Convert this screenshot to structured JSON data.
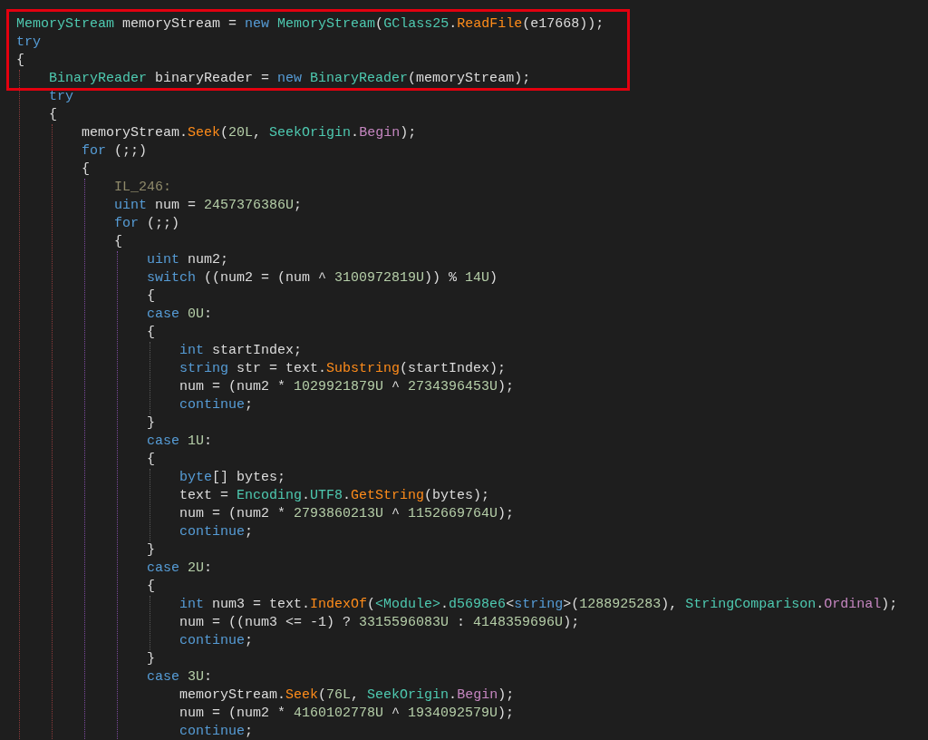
{
  "editor": {
    "lines": [
      {
        "highlighted": true,
        "tokens": [
          {
            "kind": "type",
            "text": "MemoryStream"
          },
          {
            "kind": "plain",
            "text": " memoryStream = "
          },
          {
            "kind": "keyword",
            "text": "new"
          },
          {
            "kind": "type",
            "text": " MemoryStream"
          },
          {
            "kind": "plain",
            "text": "("
          },
          {
            "kind": "type",
            "text": "GClass25"
          },
          {
            "kind": "plain",
            "text": "."
          },
          {
            "kind": "method",
            "text": "ReadFile"
          },
          {
            "kind": "plain",
            "text": "(e17668));"
          }
        ]
      },
      {
        "highlighted": true,
        "tokens": [
          {
            "kind": "keyword",
            "text": "try"
          }
        ]
      },
      {
        "highlighted": true,
        "tokens": [
          {
            "kind": "plain",
            "text": "{"
          }
        ],
        "guide": true,
        "children": [
          {
            "highlighted": true,
            "tokens": [
              {
                "kind": "type",
                "text": "BinaryReader"
              },
              {
                "kind": "plain",
                "text": " binaryReader = "
              },
              {
                "kind": "keyword",
                "text": "new"
              },
              {
                "kind": "type",
                "text": " BinaryReader"
              },
              {
                "kind": "plain",
                "text": "(memoryStream);"
              }
            ]
          },
          {
            "highlighted": false,
            "tokens": [
              {
                "kind": "keyword",
                "text": "try"
              }
            ]
          },
          {
            "highlighted": false,
            "tokens": [
              {
                "kind": "plain",
                "text": "{"
              }
            ],
            "guide": true,
            "children": [
              {
                "highlighted": false,
                "tokens": [
                  {
                    "kind": "plain",
                    "text": "memoryStream."
                  },
                  {
                    "kind": "method",
                    "text": "Seek"
                  },
                  {
                    "kind": "plain",
                    "text": "("
                  },
                  {
                    "kind": "number",
                    "text": "20L"
                  },
                  {
                    "kind": "plain",
                    "text": ", "
                  },
                  {
                    "kind": "type",
                    "text": "SeekOrigin"
                  },
                  {
                    "kind": "plain",
                    "text": "."
                  },
                  {
                    "kind": "member",
                    "text": "Begin"
                  },
                  {
                    "kind": "plain",
                    "text": ");"
                  }
                ]
              },
              {
                "highlighted": false,
                "tokens": [
                  {
                    "kind": "keyword",
                    "text": "for"
                  },
                  {
                    "kind": "plain",
                    "text": " (;;)"
                  }
                ]
              },
              {
                "highlighted": false,
                "tokens": [
                  {
                    "kind": "plain",
                    "text": "{"
                  }
                ],
                "guide": true,
                "children": [
                  {
                    "highlighted": false,
                    "tokens": [
                      {
                        "kind": "label",
                        "text": "IL_246:"
                      }
                    ]
                  },
                  {
                    "highlighted": false,
                    "tokens": [
                      {
                        "kind": "keyword",
                        "text": "uint"
                      },
                      {
                        "kind": "plain",
                        "text": " num = "
                      },
                      {
                        "kind": "number",
                        "text": "2457376386U"
                      },
                      {
                        "kind": "plain",
                        "text": ";"
                      }
                    ]
                  },
                  {
                    "highlighted": false,
                    "tokens": [
                      {
                        "kind": "keyword",
                        "text": "for"
                      },
                      {
                        "kind": "plain",
                        "text": " (;;)"
                      }
                    ]
                  },
                  {
                    "highlighted": false,
                    "tokens": [
                      {
                        "kind": "plain",
                        "text": "{"
                      }
                    ],
                    "guide": true,
                    "children": [
                      {
                        "highlighted": false,
                        "tokens": [
                          {
                            "kind": "keyword",
                            "text": "uint"
                          },
                          {
                            "kind": "plain",
                            "text": " num2;"
                          }
                        ]
                      },
                      {
                        "highlighted": false,
                        "tokens": [
                          {
                            "kind": "keyword",
                            "text": "switch"
                          },
                          {
                            "kind": "plain",
                            "text": " ((num2 = (num ^ "
                          },
                          {
                            "kind": "number",
                            "text": "3100972819U"
                          },
                          {
                            "kind": "plain",
                            "text": ")) % "
                          },
                          {
                            "kind": "number",
                            "text": "14U"
                          },
                          {
                            "kind": "plain",
                            "text": ")"
                          }
                        ]
                      },
                      {
                        "highlighted": false,
                        "tokens": [
                          {
                            "kind": "plain",
                            "text": "{"
                          }
                        ]
                      },
                      {
                        "highlighted": false,
                        "tokens": [
                          {
                            "kind": "keyword",
                            "text": "case"
                          },
                          {
                            "kind": "number",
                            "text": " 0U"
                          },
                          {
                            "kind": "plain",
                            "text": ":"
                          }
                        ]
                      },
                      {
                        "highlighted": false,
                        "tokens": [
                          {
                            "kind": "plain",
                            "text": "{"
                          }
                        ],
                        "guide": true,
                        "children": [
                          {
                            "highlighted": false,
                            "tokens": [
                              {
                                "kind": "keyword",
                                "text": "int"
                              },
                              {
                                "kind": "plain",
                                "text": " startIndex;"
                              }
                            ]
                          },
                          {
                            "highlighted": false,
                            "tokens": [
                              {
                                "kind": "keyword",
                                "text": "string"
                              },
                              {
                                "kind": "plain",
                                "text": " str = text."
                              },
                              {
                                "kind": "method",
                                "text": "Substring"
                              },
                              {
                                "kind": "plain",
                                "text": "(startIndex);"
                              }
                            ]
                          },
                          {
                            "highlighted": false,
                            "tokens": [
                              {
                                "kind": "plain",
                                "text": "num = (num2 * "
                              },
                              {
                                "kind": "number",
                                "text": "1029921879U"
                              },
                              {
                                "kind": "plain",
                                "text": " ^ "
                              },
                              {
                                "kind": "number",
                                "text": "2734396453U"
                              },
                              {
                                "kind": "plain",
                                "text": ");"
                              }
                            ]
                          },
                          {
                            "highlighted": false,
                            "tokens": [
                              {
                                "kind": "keyword",
                                "text": "continue"
                              },
                              {
                                "kind": "plain",
                                "text": ";"
                              }
                            ]
                          }
                        ]
                      },
                      {
                        "highlighted": false,
                        "tokens": [
                          {
                            "kind": "plain",
                            "text": "}"
                          }
                        ]
                      },
                      {
                        "highlighted": false,
                        "tokens": [
                          {
                            "kind": "keyword",
                            "text": "case"
                          },
                          {
                            "kind": "number",
                            "text": " 1U"
                          },
                          {
                            "kind": "plain",
                            "text": ":"
                          }
                        ]
                      },
                      {
                        "highlighted": false,
                        "tokens": [
                          {
                            "kind": "plain",
                            "text": "{"
                          }
                        ],
                        "guide": true,
                        "children": [
                          {
                            "highlighted": false,
                            "tokens": [
                              {
                                "kind": "keyword",
                                "text": "byte"
                              },
                              {
                                "kind": "plain",
                                "text": "[] bytes;"
                              }
                            ]
                          },
                          {
                            "highlighted": false,
                            "tokens": [
                              {
                                "kind": "plain",
                                "text": "text = "
                              },
                              {
                                "kind": "type",
                                "text": "Encoding"
                              },
                              {
                                "kind": "plain",
                                "text": "."
                              },
                              {
                                "kind": "type",
                                "text": "UTF8"
                              },
                              {
                                "kind": "plain",
                                "text": "."
                              },
                              {
                                "kind": "method",
                                "text": "GetString"
                              },
                              {
                                "kind": "plain",
                                "text": "(bytes);"
                              }
                            ]
                          },
                          {
                            "highlighted": false,
                            "tokens": [
                              {
                                "kind": "plain",
                                "text": "num = (num2 * "
                              },
                              {
                                "kind": "number",
                                "text": "2793860213U"
                              },
                              {
                                "kind": "plain",
                                "text": " ^ "
                              },
                              {
                                "kind": "number",
                                "text": "1152669764U"
                              },
                              {
                                "kind": "plain",
                                "text": ");"
                              }
                            ]
                          },
                          {
                            "highlighted": false,
                            "tokens": [
                              {
                                "kind": "keyword",
                                "text": "continue"
                              },
                              {
                                "kind": "plain",
                                "text": ";"
                              }
                            ]
                          }
                        ]
                      },
                      {
                        "highlighted": false,
                        "tokens": [
                          {
                            "kind": "plain",
                            "text": "}"
                          }
                        ]
                      },
                      {
                        "highlighted": false,
                        "tokens": [
                          {
                            "kind": "keyword",
                            "text": "case"
                          },
                          {
                            "kind": "number",
                            "text": " 2U"
                          },
                          {
                            "kind": "plain",
                            "text": ":"
                          }
                        ]
                      },
                      {
                        "highlighted": false,
                        "tokens": [
                          {
                            "kind": "plain",
                            "text": "{"
                          }
                        ],
                        "guide": true,
                        "children": [
                          {
                            "highlighted": false,
                            "tokens": [
                              {
                                "kind": "keyword",
                                "text": "int"
                              },
                              {
                                "kind": "plain",
                                "text": " num3 = text."
                              },
                              {
                                "kind": "method",
                                "text": "IndexOf"
                              },
                              {
                                "kind": "plain",
                                "text": "("
                              },
                              {
                                "kind": "type",
                                "text": "<Module>"
                              },
                              {
                                "kind": "plain",
                                "text": "."
                              },
                              {
                                "kind": "type",
                                "text": "d5698e6"
                              },
                              {
                                "kind": "plain",
                                "text": "<"
                              },
                              {
                                "kind": "keyword",
                                "text": "string"
                              },
                              {
                                "kind": "plain",
                                "text": ">("
                              },
                              {
                                "kind": "number",
                                "text": "1288925283"
                              },
                              {
                                "kind": "plain",
                                "text": "), "
                              },
                              {
                                "kind": "type",
                                "text": "StringComparison"
                              },
                              {
                                "kind": "plain",
                                "text": "."
                              },
                              {
                                "kind": "member",
                                "text": "Ordinal"
                              },
                              {
                                "kind": "plain",
                                "text": ");"
                              }
                            ]
                          },
                          {
                            "highlighted": false,
                            "tokens": [
                              {
                                "kind": "plain",
                                "text": "num = ((num3 <= -1) ? "
                              },
                              {
                                "kind": "number",
                                "text": "3315596083U"
                              },
                              {
                                "kind": "plain",
                                "text": " : "
                              },
                              {
                                "kind": "number",
                                "text": "4148359696U"
                              },
                              {
                                "kind": "plain",
                                "text": ");"
                              }
                            ]
                          },
                          {
                            "highlighted": false,
                            "tokens": [
                              {
                                "kind": "keyword",
                                "text": "continue"
                              },
                              {
                                "kind": "plain",
                                "text": ";"
                              }
                            ]
                          }
                        ]
                      },
                      {
                        "highlighted": false,
                        "tokens": [
                          {
                            "kind": "plain",
                            "text": "}"
                          }
                        ]
                      },
                      {
                        "highlighted": false,
                        "tokens": [
                          {
                            "kind": "keyword",
                            "text": "case"
                          },
                          {
                            "kind": "number",
                            "text": " 3U"
                          },
                          {
                            "kind": "plain",
                            "text": ":"
                          }
                        ],
                        "guide": false,
                        "children": [
                          {
                            "highlighted": false,
                            "tokens": [
                              {
                                "kind": "plain",
                                "text": "memoryStream."
                              },
                              {
                                "kind": "method",
                                "text": "Seek"
                              },
                              {
                                "kind": "plain",
                                "text": "("
                              },
                              {
                                "kind": "number",
                                "text": "76L"
                              },
                              {
                                "kind": "plain",
                                "text": ", "
                              },
                              {
                                "kind": "type",
                                "text": "SeekOrigin"
                              },
                              {
                                "kind": "plain",
                                "text": "."
                              },
                              {
                                "kind": "member",
                                "text": "Begin"
                              },
                              {
                                "kind": "plain",
                                "text": ");"
                              }
                            ]
                          },
                          {
                            "highlighted": false,
                            "tokens": [
                              {
                                "kind": "plain",
                                "text": "num = (num2 * "
                              },
                              {
                                "kind": "number",
                                "text": "4160102778U"
                              },
                              {
                                "kind": "plain",
                                "text": " ^ "
                              },
                              {
                                "kind": "number",
                                "text": "1934092579U"
                              },
                              {
                                "kind": "plain",
                                "text": ");"
                              }
                            ]
                          },
                          {
                            "highlighted": false,
                            "tokens": [
                              {
                                "kind": "keyword",
                                "text": "continue"
                              },
                              {
                                "kind": "plain",
                                "text": ";"
                              }
                            ]
                          }
                        ]
                      }
                    ]
                  }
                ]
              }
            ]
          }
        ]
      }
    ]
  }
}
